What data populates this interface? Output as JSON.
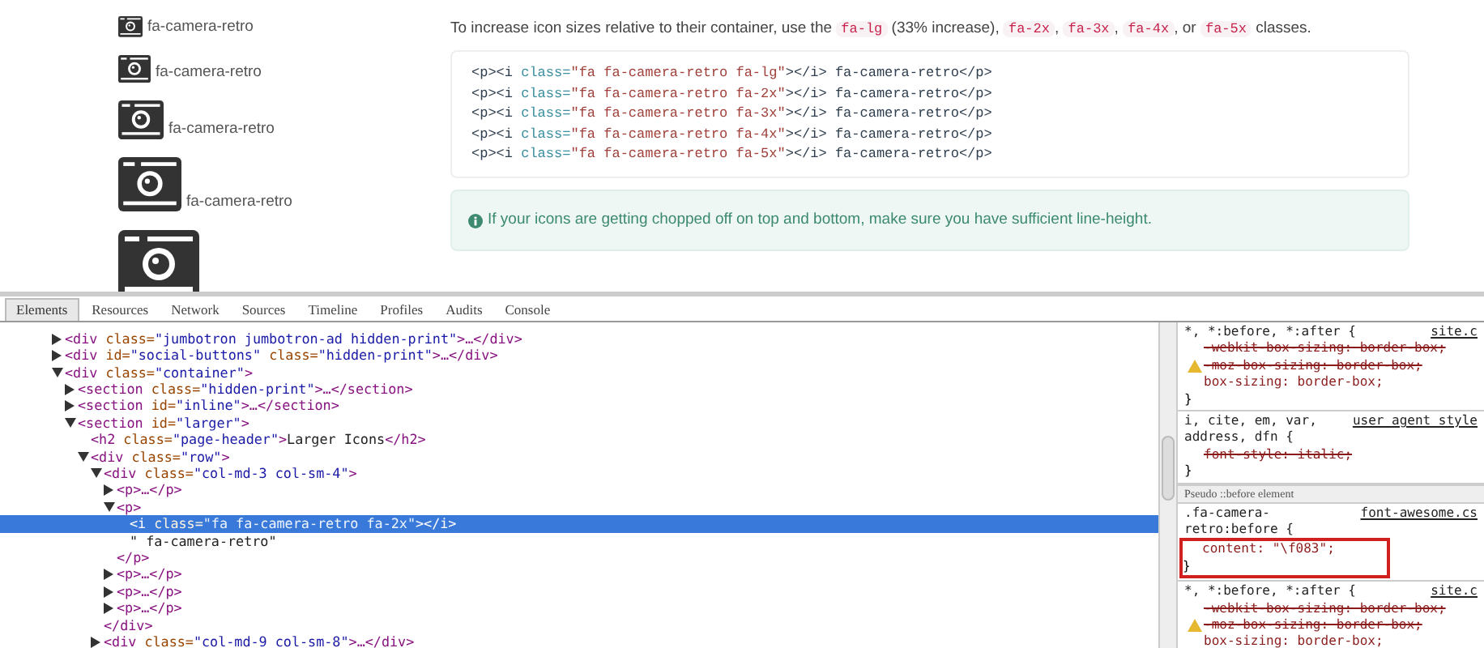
{
  "page": {
    "icons": [
      {
        "kind": "large",
        "label": "fa-camera-retro"
      },
      {
        "kind": "double",
        "label": "fa-camera-retro"
      },
      {
        "kind": "triple",
        "label": "fa-camera-retro"
      },
      {
        "kind": "fourfold",
        "label": "fa-camera-retro"
      },
      {
        "kind": "fivefold"
      }
    ],
    "intro": [
      {
        "kind": "text",
        "s": "To increase icon sizes relative to their container, use the "
      },
      {
        "kind": "code",
        "s": "fa-lg"
      },
      {
        "kind": "text",
        "s": " (33% increase), "
      },
      {
        "kind": "code",
        "s": "fa-2x"
      },
      {
        "kind": "text",
        "s": ", "
      },
      {
        "kind": "code",
        "s": "fa-3x"
      },
      {
        "kind": "text",
        "s": ", "
      },
      {
        "kind": "code",
        "s": "fa-4x"
      },
      {
        "kind": "text",
        "s": ", or "
      },
      {
        "kind": "code",
        "s": "fa-5x"
      },
      {
        "kind": "text",
        "s": " classes."
      }
    ],
    "code_lines": [
      [
        {
          "kind": "tag",
          "s": "<p><i "
        },
        {
          "kind": "attr",
          "s": "class="
        },
        {
          "kind": "value",
          "s": "\"fa fa-camera-retro fa-lg\""
        },
        {
          "kind": "tag",
          "s": "></i> fa-camera-retro</p>"
        }
      ],
      [
        {
          "kind": "tag",
          "s": "<p><i "
        },
        {
          "kind": "attr",
          "s": "class="
        },
        {
          "kind": "value",
          "s": "\"fa fa-camera-retro fa-2x\""
        },
        {
          "kind": "tag",
          "s": "></i> fa-camera-retro</p>"
        }
      ],
      [
        {
          "kind": "tag",
          "s": "<p><i "
        },
        {
          "kind": "attr",
          "s": "class="
        },
        {
          "kind": "value",
          "s": "\"fa fa-camera-retro fa-3x\""
        },
        {
          "kind": "tag",
          "s": "></i> fa-camera-retro</p>"
        }
      ],
      [
        {
          "kind": "tag",
          "s": "<p><i "
        },
        {
          "kind": "attr",
          "s": "class="
        },
        {
          "kind": "value",
          "s": "\"fa fa-camera-retro fa-4x\""
        },
        {
          "kind": "tag",
          "s": "></i> fa-camera-retro</p>"
        }
      ],
      [
        {
          "kind": "tag",
          "s": "<p><i "
        },
        {
          "kind": "attr",
          "s": "class="
        },
        {
          "kind": "value",
          "s": "\"fa fa-camera-retro fa-5x\""
        },
        {
          "kind": "tag",
          "s": "></i> fa-camera-retro</p>"
        }
      ]
    ],
    "alert": "If your icons are getting chopped off on top and bottom, make sure you have sufficient line-height."
  },
  "devtools": {
    "tabs": [
      {
        "label": "Elements",
        "selected": true
      },
      {
        "label": "Resources",
        "selected": false
      },
      {
        "label": "Network",
        "selected": false
      },
      {
        "label": "Sources",
        "selected": false
      },
      {
        "label": "Timeline",
        "selected": false
      },
      {
        "label": "Profiles",
        "selected": false
      },
      {
        "label": "Audits",
        "selected": false
      },
      {
        "label": "Console",
        "selected": false
      }
    ],
    "dom_tree": [
      {
        "kind": "collapsed",
        "selected": false,
        "parts": [
          {
            "kind": "tag",
            "s": "<div"
          },
          {
            "kind": "attr",
            "s": " class="
          },
          {
            "kind": "value",
            "s": "\"jumbotron jumbotron-ad hidden-print\""
          },
          {
            "kind": "tag",
            "s": ">…</div>"
          }
        ]
      },
      {
        "kind": "collapsed",
        "selected": false,
        "parts": [
          {
            "kind": "tag",
            "s": "<div"
          },
          {
            "kind": "attr",
            "s": " id="
          },
          {
            "kind": "value",
            "s": "\"social-buttons\""
          },
          {
            "kind": "attr",
            "s": " class="
          },
          {
            "kind": "value",
            "s": "\"hidden-print\""
          },
          {
            "kind": "tag",
            "s": ">…</div>"
          }
        ]
      },
      {
        "kind": "expanded",
        "selected": false,
        "parts": [
          {
            "kind": "tag",
            "s": "<div"
          },
          {
            "kind": "attr",
            "s": " class="
          },
          {
            "kind": "value",
            "s": "\"container\""
          },
          {
            "kind": "tag",
            "s": ">"
          }
        ],
        "children": [
          {
            "kind": "collapsed",
            "selected": false,
            "parts": [
              {
                "kind": "tag",
                "s": "<section"
              },
              {
                "kind": "attr",
                "s": " class="
              },
              {
                "kind": "value",
                "s": "\"hidden-print\""
              },
              {
                "kind": "tag",
                "s": ">…</section>"
              }
            ]
          },
          {
            "kind": "collapsed",
            "selected": false,
            "parts": [
              {
                "kind": "tag",
                "s": "<section"
              },
              {
                "kind": "attr",
                "s": " id="
              },
              {
                "kind": "value",
                "s": "\"inline\""
              },
              {
                "kind": "tag",
                "s": ">…</section>"
              }
            ]
          },
          {
            "kind": "expanded",
            "selected": false,
            "parts": [
              {
                "kind": "tag",
                "s": "<section"
              },
              {
                "kind": "attr",
                "s": " id="
              },
              {
                "kind": "value",
                "s": "\"larger\""
              },
              {
                "kind": "tag",
                "s": ">"
              }
            ],
            "children": [
              {
                "kind": "leaf",
                "selected": false,
                "parts": [
                  {
                    "kind": "tag",
                    "s": "<h2"
                  },
                  {
                    "kind": "attr",
                    "s": " class="
                  },
                  {
                    "kind": "value",
                    "s": "\"page-header\""
                  },
                  {
                    "kind": "tag",
                    "s": ">"
                  },
                  {
                    "kind": "text",
                    "s": "Larger Icons"
                  },
                  {
                    "kind": "tag",
                    "s": "</h2>"
                  }
                ]
              },
              {
                "kind": "expanded",
                "selected": false,
                "parts": [
                  {
                    "kind": "tag",
                    "s": "<div"
                  },
                  {
                    "kind": "attr",
                    "s": " class="
                  },
                  {
                    "kind": "value",
                    "s": "\"row\""
                  },
                  {
                    "kind": "tag",
                    "s": ">"
                  }
                ],
                "children": [
                  {
                    "kind": "expanded",
                    "selected": false,
                    "parts": [
                      {
                        "kind": "tag",
                        "s": "<div"
                      },
                      {
                        "kind": "attr",
                        "s": " class="
                      },
                      {
                        "kind": "value",
                        "s": "\"col-md-3 col-sm-4\""
                      },
                      {
                        "kind": "tag",
                        "s": ">"
                      }
                    ],
                    "close": "</div>",
                    "children": [
                      {
                        "kind": "collapsed",
                        "selected": false,
                        "parts": [
                          {
                            "kind": "tag",
                            "s": "<p>…</p>"
                          }
                        ]
                      },
                      {
                        "kind": "expanded",
                        "selected": false,
                        "parts": [
                          {
                            "kind": "tag",
                            "s": "<p>"
                          }
                        ],
                        "close": "</p>",
                        "children": [
                          {
                            "kind": "leaf",
                            "selected": true,
                            "parts": [
                              {
                                "kind": "tag",
                                "s": "<i"
                              },
                              {
                                "kind": "attr",
                                "s": " class="
                              },
                              {
                                "kind": "value",
                                "s": "\"fa fa-camera-retro fa-2x\""
                              },
                              {
                                "kind": "tag",
                                "s": "></i>"
                              }
                            ]
                          },
                          {
                            "kind": "leaf",
                            "selected": false,
                            "parts": [
                              {
                                "kind": "text",
                                "s": "\" fa-camera-retro\""
                              }
                            ]
                          }
                        ]
                      },
                      {
                        "kind": "collapsed",
                        "selected": false,
                        "parts": [
                          {
                            "kind": "tag",
                            "s": "<p>…</p>"
                          }
                        ]
                      },
                      {
                        "kind": "collapsed",
                        "selected": false,
                        "parts": [
                          {
                            "kind": "tag",
                            "s": "<p>…</p>"
                          }
                        ]
                      },
                      {
                        "kind": "collapsed",
                        "selected": false,
                        "parts": [
                          {
                            "kind": "tag",
                            "s": "<p>…</p>"
                          }
                        ]
                      }
                    ]
                  },
                  {
                    "kind": "collapsed",
                    "selected": false,
                    "parts": [
                      {
                        "kind": "tag",
                        "s": "<div"
                      },
                      {
                        "kind": "attr",
                        "s": " class="
                      },
                      {
                        "kind": "value",
                        "s": "\"col-md-9 col-sm-8\""
                      },
                      {
                        "kind": "tag",
                        "s": ">…</div>"
                      }
                    ]
                  }
                ]
              }
            ]
          }
        ]
      }
    ],
    "styles": [
      {
        "kind": "rule",
        "selector": "*, *:before, *:after {",
        "source": "site.c",
        "highlighted": false,
        "declarations": [
          {
            "text": "-webkit-box-sizing: border-box;",
            "struck": true,
            "warning": false
          },
          {
            "text": "-moz-box-sizing: border-box;",
            "struck": true,
            "warning": true
          },
          {
            "text": "box-sizing: border-box;",
            "struck": false,
            "warning": false
          }
        ],
        "close": "}"
      },
      {
        "kind": "rule",
        "selector": "i, cite, em, var, address, dfn {",
        "source": "user agent style",
        "highlighted": false,
        "declarations": [
          {
            "text": "font-style: italic;",
            "struck": true,
            "warning": false
          }
        ],
        "close": "}"
      },
      {
        "kind": "header",
        "label": "Pseudo ::before element"
      },
      {
        "kind": "rule",
        "selector": ".fa-camera-retro:before {",
        "source": "font-awesome.cs",
        "highlighted": true,
        "declarations": [
          {
            "text": "content: \"\\f083\";",
            "struck": false,
            "warning": false
          }
        ],
        "close": "}"
      },
      {
        "kind": "rule",
        "selector": "*, *:before, *:after {",
        "source": "site.c",
        "highlighted": false,
        "declarations": [
          {
            "text": "-webkit-box-sizing: border-box;",
            "struck": true,
            "warning": false
          },
          {
            "text": "-moz-box-sizing: border-box;",
            "struck": true,
            "warning": true
          },
          {
            "text": "box-sizing: border-box;",
            "struck": false,
            "warning": false
          }
        ]
      }
    ]
  }
}
